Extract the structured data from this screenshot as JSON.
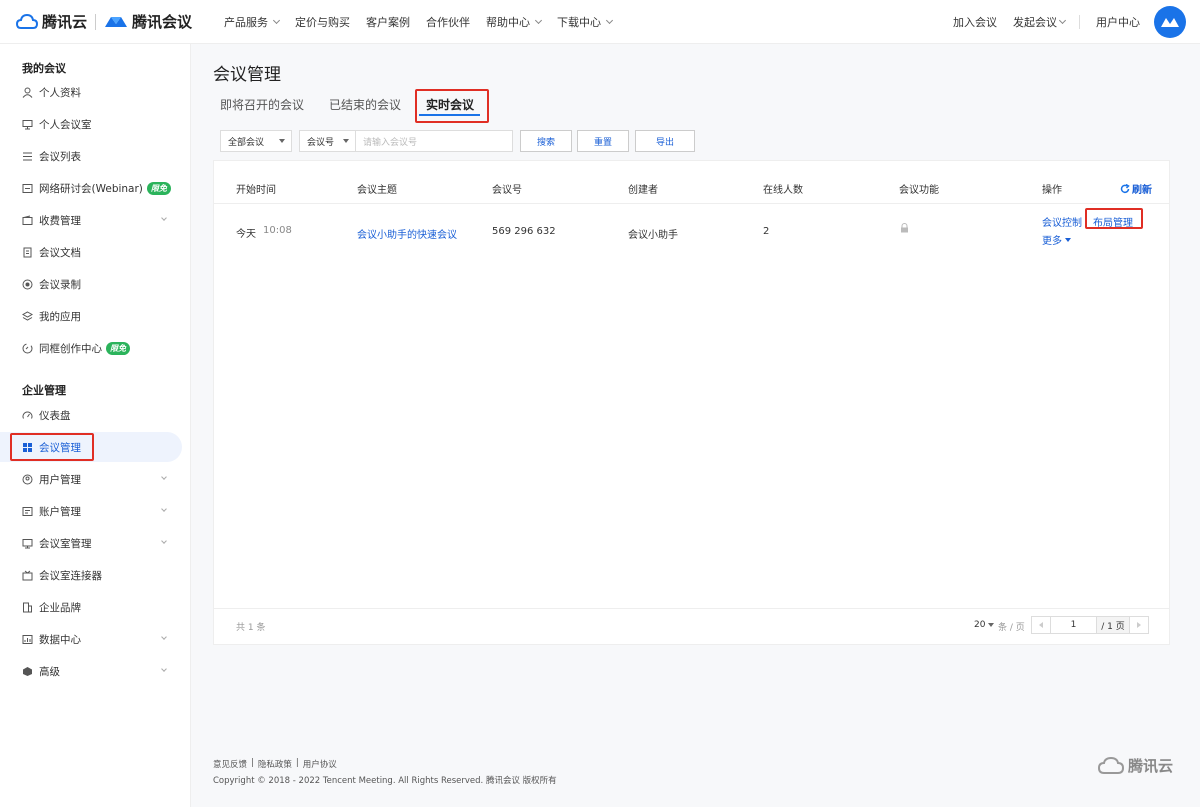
{
  "header": {
    "brand_cloud": "腾讯云",
    "brand_meeting": "腾讯会议",
    "nav": [
      {
        "label": "产品服务",
        "dropdown": true
      },
      {
        "label": "定价与购买",
        "dropdown": false
      },
      {
        "label": "客户案例",
        "dropdown": false
      },
      {
        "label": "合作伙伴",
        "dropdown": false
      },
      {
        "label": "帮助中心",
        "dropdown": true
      },
      {
        "label": "下载中心",
        "dropdown": true
      }
    ],
    "join_meeting": "加入会议",
    "start_meeting": "发起会议",
    "user_center": "用户中心"
  },
  "sidebar": {
    "section1_title": "我的会议",
    "section2_title": "企业管理",
    "items": [
      {
        "label": "个人资料",
        "icon": "user-icon"
      },
      {
        "label": "个人会议室",
        "icon": "monitor-icon"
      },
      {
        "label": "会议列表",
        "icon": "list-icon"
      },
      {
        "label": "网络研讨会(Webinar)",
        "icon": "webinar-icon",
        "badge": "限免"
      },
      {
        "label": "收费管理",
        "icon": "wallet-icon"
      },
      {
        "label": "会议文档",
        "icon": "document-icon"
      },
      {
        "label": "会议录制",
        "icon": "record-icon"
      },
      {
        "label": "我的应用",
        "icon": "layers-icon"
      },
      {
        "label": "同框创作中心",
        "icon": "creation-icon",
        "badge": "限免"
      },
      {
        "label": "仪表盘",
        "icon": "dashboard-icon"
      },
      {
        "label": "会议管理",
        "icon": "grid-icon"
      },
      {
        "label": "用户管理",
        "icon": "users-icon"
      },
      {
        "label": "账户管理",
        "icon": "account-icon"
      },
      {
        "label": "会议室管理",
        "icon": "room-icon"
      },
      {
        "label": "会议室连接器",
        "icon": "connector-icon"
      },
      {
        "label": "企业品牌",
        "icon": "building-icon"
      },
      {
        "label": "数据中心",
        "icon": "data-icon"
      },
      {
        "label": "高级",
        "icon": "cube-icon"
      }
    ]
  },
  "main": {
    "title": "会议管理",
    "tabs": [
      "即将召开的会议",
      "已结束的会议",
      "实时会议"
    ],
    "active_tab": "实时会议",
    "filter": {
      "meeting_type": "全部会议",
      "search_field": "会议号",
      "search_placeholder": "请输入会议号"
    },
    "buttons": {
      "search": "搜索",
      "reset": "重置",
      "export": "导出"
    },
    "table": {
      "columns": [
        "开始时间",
        "会议主题",
        "会议号",
        "创建者",
        "在线人数",
        "会议功能",
        "操作"
      ],
      "refresh": "刷新",
      "rows": [
        {
          "date": "今天",
          "time": "10:08",
          "topic": "会议小助手的快速会议",
          "meeting_id": "569 296 632",
          "creator": "会议小助手",
          "online": "2",
          "actions": {
            "control": "会议控制",
            "layout": "布局管理",
            "more": "更多"
          }
        }
      ]
    },
    "pagination": {
      "total": "共 1 条",
      "page_size": "20",
      "per_page_unit": "条 / 页",
      "current_page": "1",
      "total_pages": "/ 1 页"
    }
  },
  "footer": {
    "feedback": "意见反馈",
    "privacy": "隐私政策",
    "agreement": "用户协议",
    "copyright": "Copyright © 2018 - 2022 Tencent Meeting. All Rights Reserved. 腾讯会议 版权所有",
    "logo_text": "腾讯云"
  },
  "colors": {
    "accent": "#1a73e8",
    "link": "#1a5fd6",
    "badge": "#2bb35b",
    "highlight": "#e02e24"
  }
}
